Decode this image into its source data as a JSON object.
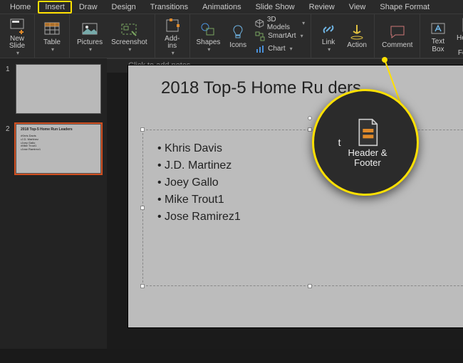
{
  "tabs": {
    "items": [
      "Home",
      "Insert",
      "Draw",
      "Design",
      "Transitions",
      "Animations",
      "Slide Show",
      "Review",
      "View",
      "Shape Format"
    ],
    "active": "Insert"
  },
  "ribbon": {
    "new_slide": "New Slide",
    "table": "Table",
    "pictures": "Pictures",
    "screenshot": "Screenshot",
    "addins": "Add-ins",
    "shapes": "Shapes",
    "icons": "Icons",
    "models3d": "3D Models",
    "smartart": "SmartArt",
    "chart": "Chart",
    "link": "Link",
    "action": "Action",
    "comment": "Comment",
    "textbox": "Text Box",
    "header_footer_l1": "Header &",
    "header_footer_l2": "Footer"
  },
  "thumbnails": [
    {
      "number": "1",
      "title": "",
      "lines": []
    },
    {
      "number": "2",
      "title": "2018 Top-5 Home Run Leaders",
      "lines": [
        "•Khris Davis",
        "•J.D. Martinez",
        "•Joey Gallo",
        "•Mike Trout1",
        "•Jose Ramirez1"
      ]
    }
  ],
  "slide": {
    "title": "2018 Top-5 Home Run Leaders",
    "title_visible": "2018 Top-5 Home Ru         ders",
    "bullets": [
      "Khris Davis",
      "J.D. Martinez",
      "Joey Gallo",
      "Mike Trout1",
      "Jose Ramirez1"
    ]
  },
  "magnifier": {
    "partial_left": "t",
    "label_l1": "Header &",
    "label_l2": "Footer"
  },
  "notes_placeholder": "Click to add notes"
}
